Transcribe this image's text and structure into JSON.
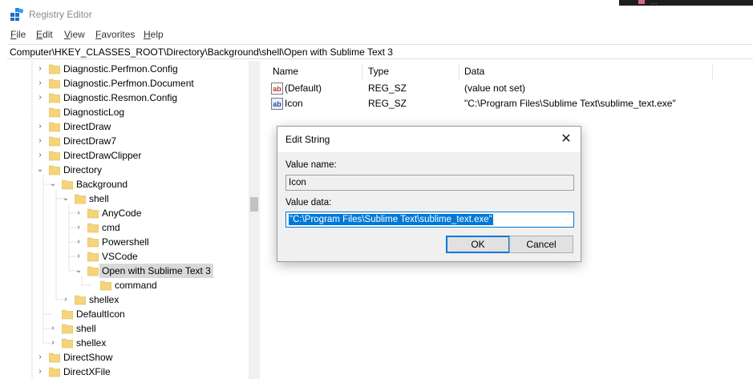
{
  "window": {
    "title": "Registry Editor",
    "background_text": "..."
  },
  "menu": [
    {
      "label": "File"
    },
    {
      "label": "Edit"
    },
    {
      "label": "View"
    },
    {
      "label": "Favorites"
    },
    {
      "label": "Help"
    }
  ],
  "address": {
    "path": "Computer\\HKEY_CLASSES_ROOT\\Directory\\Background\\shell\\Open with Sublime Text 3"
  },
  "tree": [
    {
      "label": "Diagnostic.Perfmon.Config",
      "depth": 0,
      "expander": "collapsed"
    },
    {
      "label": "Diagnostic.Perfmon.Document",
      "depth": 0,
      "expander": "collapsed"
    },
    {
      "label": "Diagnostic.Resmon.Config",
      "depth": 0,
      "expander": "collapsed"
    },
    {
      "label": "DiagnosticLog",
      "depth": 0,
      "expander": "none"
    },
    {
      "label": "DirectDraw",
      "depth": 0,
      "expander": "collapsed"
    },
    {
      "label": "DirectDraw7",
      "depth": 0,
      "expander": "collapsed"
    },
    {
      "label": "DirectDrawClipper",
      "depth": 0,
      "expander": "collapsed"
    },
    {
      "label": "Directory",
      "depth": 0,
      "expander": "expanded"
    },
    {
      "label": "Background",
      "depth": 1,
      "expander": "expanded"
    },
    {
      "label": "shell",
      "depth": 2,
      "expander": "expanded"
    },
    {
      "label": "AnyCode",
      "depth": 3,
      "expander": "collapsed"
    },
    {
      "label": "cmd",
      "depth": 3,
      "expander": "collapsed"
    },
    {
      "label": "Powershell",
      "depth": 3,
      "expander": "collapsed"
    },
    {
      "label": "VSCode",
      "depth": 3,
      "expander": "collapsed"
    },
    {
      "label": "Open with Sublime Text 3",
      "depth": 3,
      "expander": "expanded",
      "selected": true
    },
    {
      "label": "command",
      "depth": 4,
      "expander": "none"
    },
    {
      "label": "shellex",
      "depth": 2,
      "expander": "collapsed"
    },
    {
      "label": "DefaultIcon",
      "depth": 1,
      "expander": "none"
    },
    {
      "label": "shell",
      "depth": 1,
      "expander": "collapsed"
    },
    {
      "label": "shellex",
      "depth": 1,
      "expander": "collapsed"
    },
    {
      "label": "DirectShow",
      "depth": 0,
      "expander": "collapsed"
    },
    {
      "label": "DirectXFile",
      "depth": 0,
      "expander": "collapsed"
    }
  ],
  "list": {
    "columns": [
      "Name",
      "Type",
      "Data"
    ],
    "rows": [
      {
        "icon": "ab",
        "name": "(Default)",
        "type": "REG_SZ",
        "data": "(value not set)"
      },
      {
        "icon": "ab",
        "name": "Icon",
        "type": "REG_SZ",
        "data": "\"C:\\Program Files\\Sublime Text\\sublime_text.exe\""
      }
    ]
  },
  "dialog": {
    "title": "Edit String",
    "close_glyph": "✕",
    "value_name_label": "Value name:",
    "value_name": "Icon",
    "value_data_label": "Value data:",
    "value_data": "\"C:\\Program Files\\Sublime Text\\sublime_text.exe\"",
    "ok_label": "OK",
    "cancel_label": "Cancel"
  },
  "colors": {
    "accent": "#0078d7",
    "folder": "#f5d47a",
    "selection": "#d9d9d9"
  }
}
